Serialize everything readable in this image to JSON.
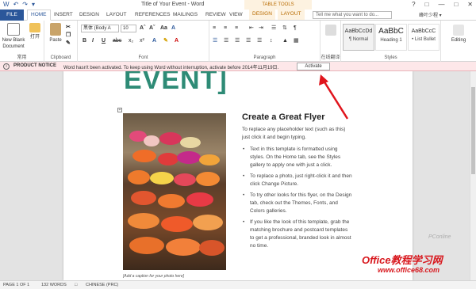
{
  "titlebar": {
    "title": "Title of Your Event - Word",
    "context_header": "TABLE TOOLS",
    "qat": [
      "W",
      "↶",
      "↷",
      "▾"
    ],
    "controls": [
      "?",
      "□",
      "—",
      "□",
      "✕"
    ]
  },
  "tabs": {
    "file": "FILE",
    "home": "HOME",
    "insert": "INSERT",
    "design": "DESIGN",
    "layout": "LAYOUT",
    "references": "REFERENCES",
    "mailings": "MAILINGS",
    "review": "REVIEW",
    "view": "VIEW",
    "table_design": "DESIGN",
    "table_layout": "LAYOUT",
    "tellme_placeholder": "Tell me what you want to do...",
    "user": "峰叶少程 ▾"
  },
  "ribbon": {
    "new_blank": "New Blank",
    "new_blank2": "Document",
    "open": "打开",
    "group_common": "常用",
    "paste": "Paste",
    "group_clipboard": "Clipboard",
    "font_name": "黑体 (Body A",
    "font_size": "10",
    "group_font": "Font",
    "group_paragraph": "Paragraph",
    "group_convert": "在线翻译",
    "styles": [
      {
        "preview": "AaBbCcDd",
        "name": "¶ Normal"
      },
      {
        "preview": "AaBbC",
        "name": "Heading 1"
      },
      {
        "preview": "AaBbCcC",
        "name": "• List Bullet"
      }
    ],
    "group_styles": "Styles",
    "editing": "Editing",
    "font_buttons": [
      "Aˆ",
      "Aˇ",
      "Aa",
      "A"
    ],
    "format_buttons": [
      "B",
      "I",
      "U",
      "abc",
      "x₂",
      "x²",
      "A",
      "✎",
      "A"
    ]
  },
  "notice": {
    "label": "PRODUCT NOTICE",
    "message": "Word hasn't been activated. To keep using Word without interruption, activate before 2014年11月19日.",
    "button": "Activate"
  },
  "document": {
    "big_title": "EVENT]",
    "flyer_title": "Create a Great Flyer",
    "intro": "To replace any placeholder text (such as this) just click it and begin typing.",
    "bullets": [
      "Text in this template is formatted using styles. On the Home tab, see the Styles gallery to apply one with just a click.",
      "To replace a photo, just right-click it and then click Change Picture.",
      "To try other looks for this flyer, on the Design tab, check out the Themes, Fonts, and Colors galleries.",
      "If you like the look of this template, grab the matching brochure and postcard templates to get a professional, branded look in almost no time."
    ],
    "caption": "[Add a caption for your photo here]",
    "para_mark": "↵",
    "anchor": "+"
  },
  "status": {
    "page": "PAGE 1 OF 1",
    "words": "132 WORDS",
    "language": "CHINESE (PRC)"
  },
  "watermark": {
    "line1": "Office教程学习网",
    "line2": "www.office68.com",
    "faint": "PConline"
  },
  "colors": {
    "accent": "#2b579a",
    "title_green": "#2e8b76",
    "notice_bg": "#fde7e9",
    "arrow": "#e0141c"
  }
}
